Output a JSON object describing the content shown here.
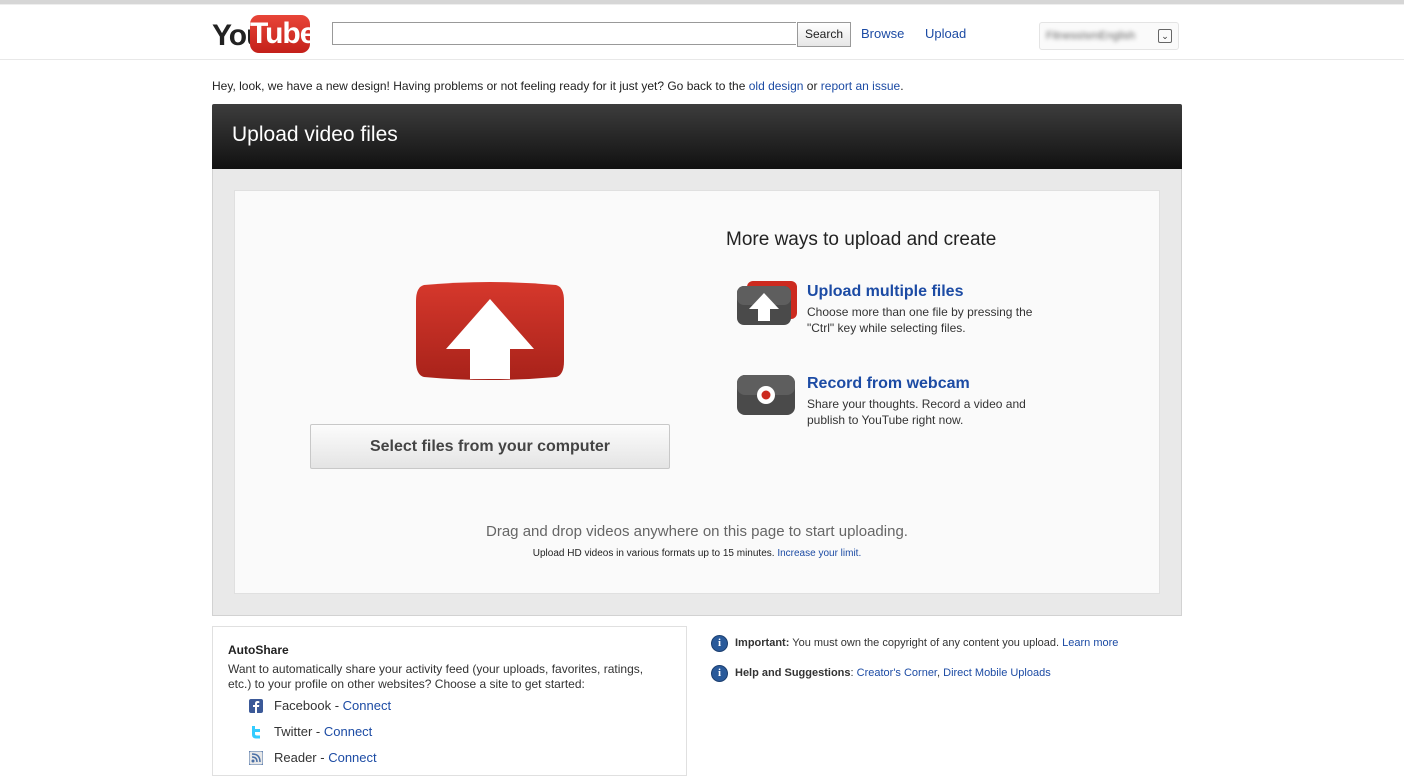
{
  "header": {
    "logo_you": "You",
    "logo_tube": "Tube",
    "search_value": "",
    "search_button": "Search",
    "nav_browse": "Browse",
    "nav_upload": "Upload",
    "username": "FitnessIsmEnglish"
  },
  "notice": {
    "text": "Hey, look, we have a new design! Having problems or not feeling ready for it just yet? Go back to the ",
    "old_design_link": "old design",
    "or": " or ",
    "report_link": "report an issue",
    "end": "."
  },
  "panel": {
    "title": "Upload video files",
    "select_button": "Select files from your computer",
    "more_title": "More ways to upload and create",
    "options": [
      {
        "icon": "upload-multiple-icon",
        "title": "Upload multiple files",
        "desc": "Choose more than one file by pressing the \"Ctrl\" key while selecting files."
      },
      {
        "icon": "webcam-icon",
        "title": "Record from webcam",
        "desc": "Share your thoughts. Record a video and publish to YouTube right now."
      }
    ],
    "drag_text": "Drag and drop videos anywhere on this page to start uploading.",
    "hd_text": "Upload HD videos in various formats up to 15 minutes. ",
    "increase_link": "Increase your limit."
  },
  "autoshare": {
    "title": "AutoShare",
    "desc": "Want to automatically share your activity feed (your uploads, favorites, ratings, etc.) to your profile on other websites? Choose a site to get started:",
    "sites": [
      {
        "name": "Facebook",
        "icon": "facebook-icon",
        "connect": "Connect",
        "color": "#3b5998"
      },
      {
        "name": "Twitter",
        "icon": "twitter-icon",
        "connect": "Connect",
        "color": "#33ccff"
      },
      {
        "name": "Reader",
        "icon": "reader-icon",
        "connect": "Connect",
        "color": "#4a6fa5"
      }
    ],
    "separator": " - "
  },
  "info": {
    "important_label": "Important:",
    "important_text": " You must own the copyright of any content you upload. ",
    "learn_more": "Learn more",
    "help_label": "Help and Suggestions",
    "help_colon": ": ",
    "creators_corner": "Creator's Corner",
    "comma": ", ",
    "mobile_uploads": "Direct Mobile Uploads"
  },
  "colors": {
    "link": "#1c4ba4",
    "brand_red": "#cc2a1f",
    "panel_header": "#1a1a1a"
  }
}
